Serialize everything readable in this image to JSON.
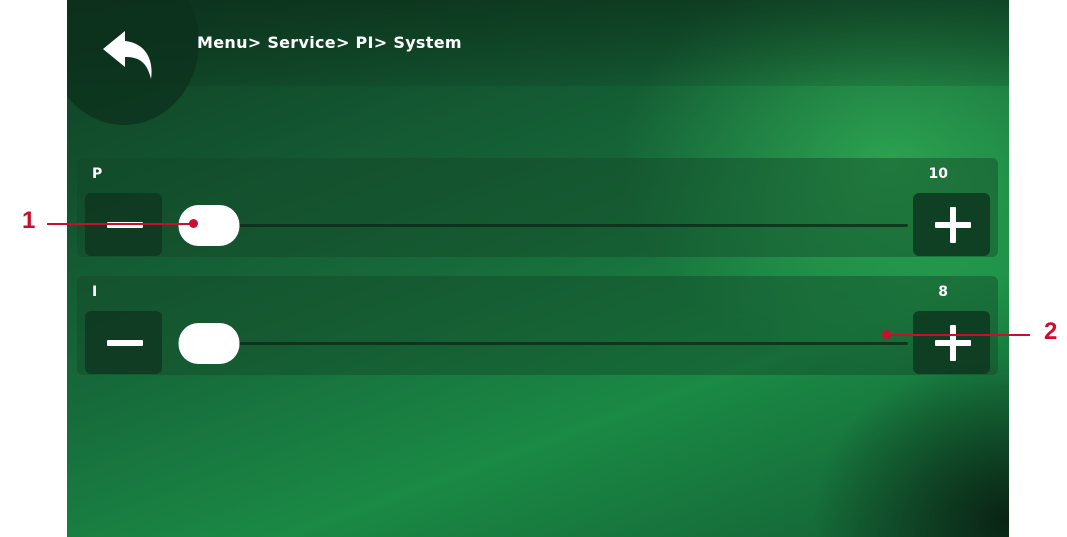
{
  "breadcrumb": "Menu> Service> PI> System",
  "icons": {
    "back": "back-arrow-icon",
    "minus": "minus-icon",
    "plus": "plus-icon"
  },
  "colors": {
    "accent": "#1a8a45",
    "callout": "#c8102e"
  },
  "sliders": [
    {
      "label": "P",
      "value": "10",
      "fraction": 0.0
    },
    {
      "label": "I",
      "value": "8",
      "fraction": 0.0
    }
  ],
  "callouts": {
    "one": "1",
    "two": "2"
  }
}
